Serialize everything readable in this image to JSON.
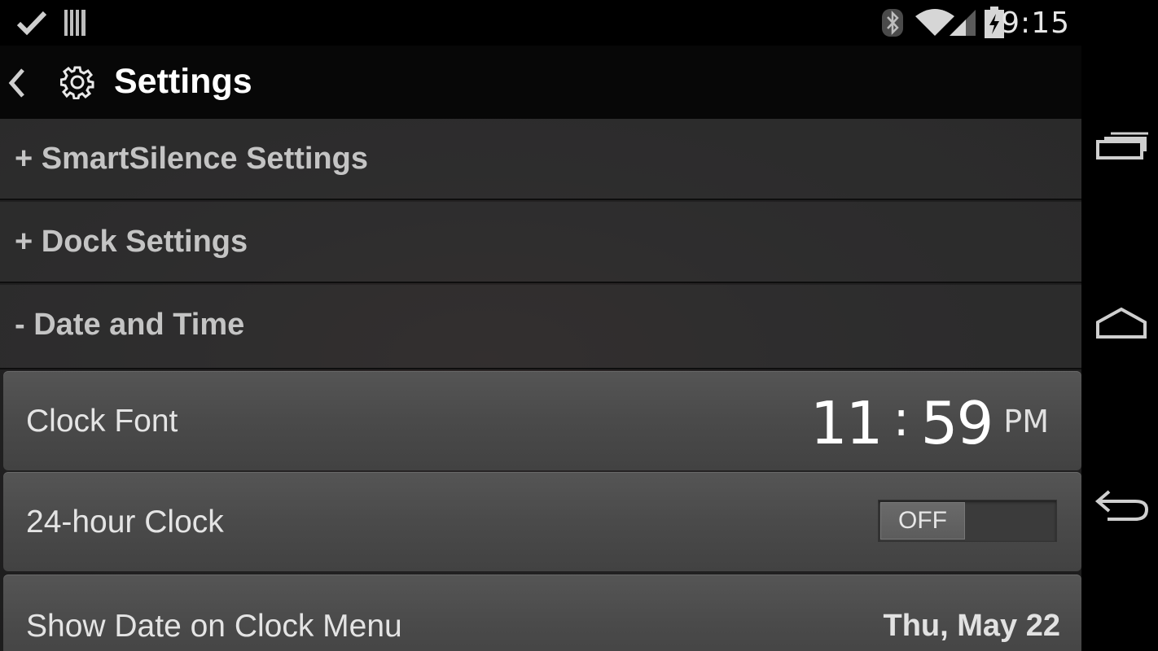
{
  "status_bar": {
    "time": "9:15",
    "icons": [
      "checkmark-icon",
      "barcode-icon",
      "bluetooth-icon",
      "wifi-icon",
      "signal-icon",
      "battery-charging-icon"
    ]
  },
  "action_bar": {
    "title": "Settings",
    "back_icon": "chevron-left-icon",
    "app_icon": "gear-icon"
  },
  "sections": [
    {
      "label": "+ SmartSilence Settings",
      "expanded": false
    },
    {
      "label": "+ Dock Settings",
      "expanded": false
    },
    {
      "label": "- Date and Time",
      "expanded": true
    }
  ],
  "rows": {
    "clock_font": {
      "label": "Clock Font",
      "hour": "11",
      "colon": ":",
      "minute": "59",
      "ampm": "PM"
    },
    "hour24": {
      "label": "24-hour Clock",
      "toggle_state": "OFF"
    },
    "show_date": {
      "label": "Show Date on Clock Menu",
      "value": "Thu, May 22"
    }
  },
  "nav_bar": {
    "buttons": [
      "recent-apps-icon",
      "home-icon",
      "back-arrow-icon"
    ]
  },
  "colors": {
    "background": "#000000",
    "section_text": "#c4c4c4",
    "row_bg": "#4a4a4a",
    "row_text": "#e4e4e4"
  }
}
